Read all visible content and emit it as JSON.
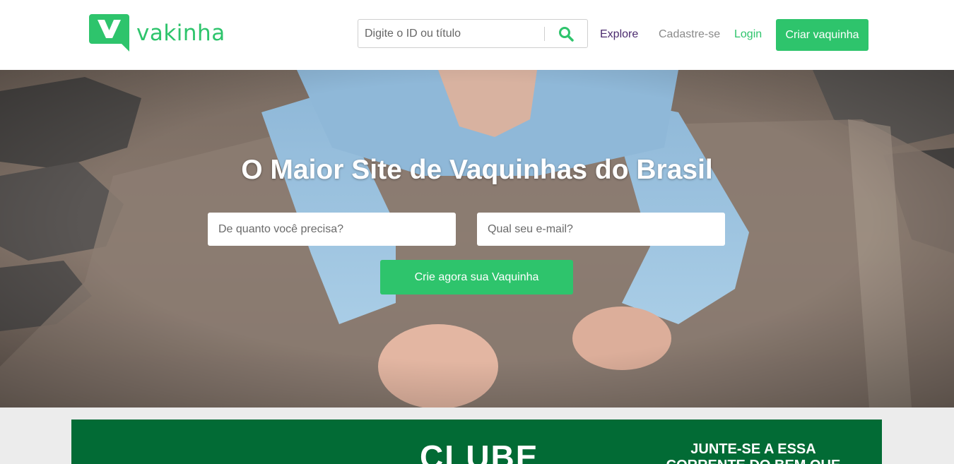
{
  "header": {
    "logo_text": "vakinha",
    "search": {
      "placeholder": "Digite o ID ou título"
    },
    "nav": {
      "explore": "Explore",
      "signup": "Cadastre-se",
      "login": "Login",
      "create": "Criar vaquinha"
    }
  },
  "hero": {
    "title": "O Maior Site de Vaquinhas do Brasil",
    "amount_placeholder": "De quanto você precisa?",
    "email_placeholder": "Qual seu e-mail?",
    "cta": "Crie agora sua Vaquinha"
  },
  "club": {
    "title": "CLUBE",
    "side_line1": "JUNTE-SE A ESSA",
    "side_line2": "CORRENTE DO BEM QUE"
  },
  "colors": {
    "brand_green": "#2ec46c",
    "club_green": "#026b35",
    "explore_purple": "#4b2a6e"
  }
}
